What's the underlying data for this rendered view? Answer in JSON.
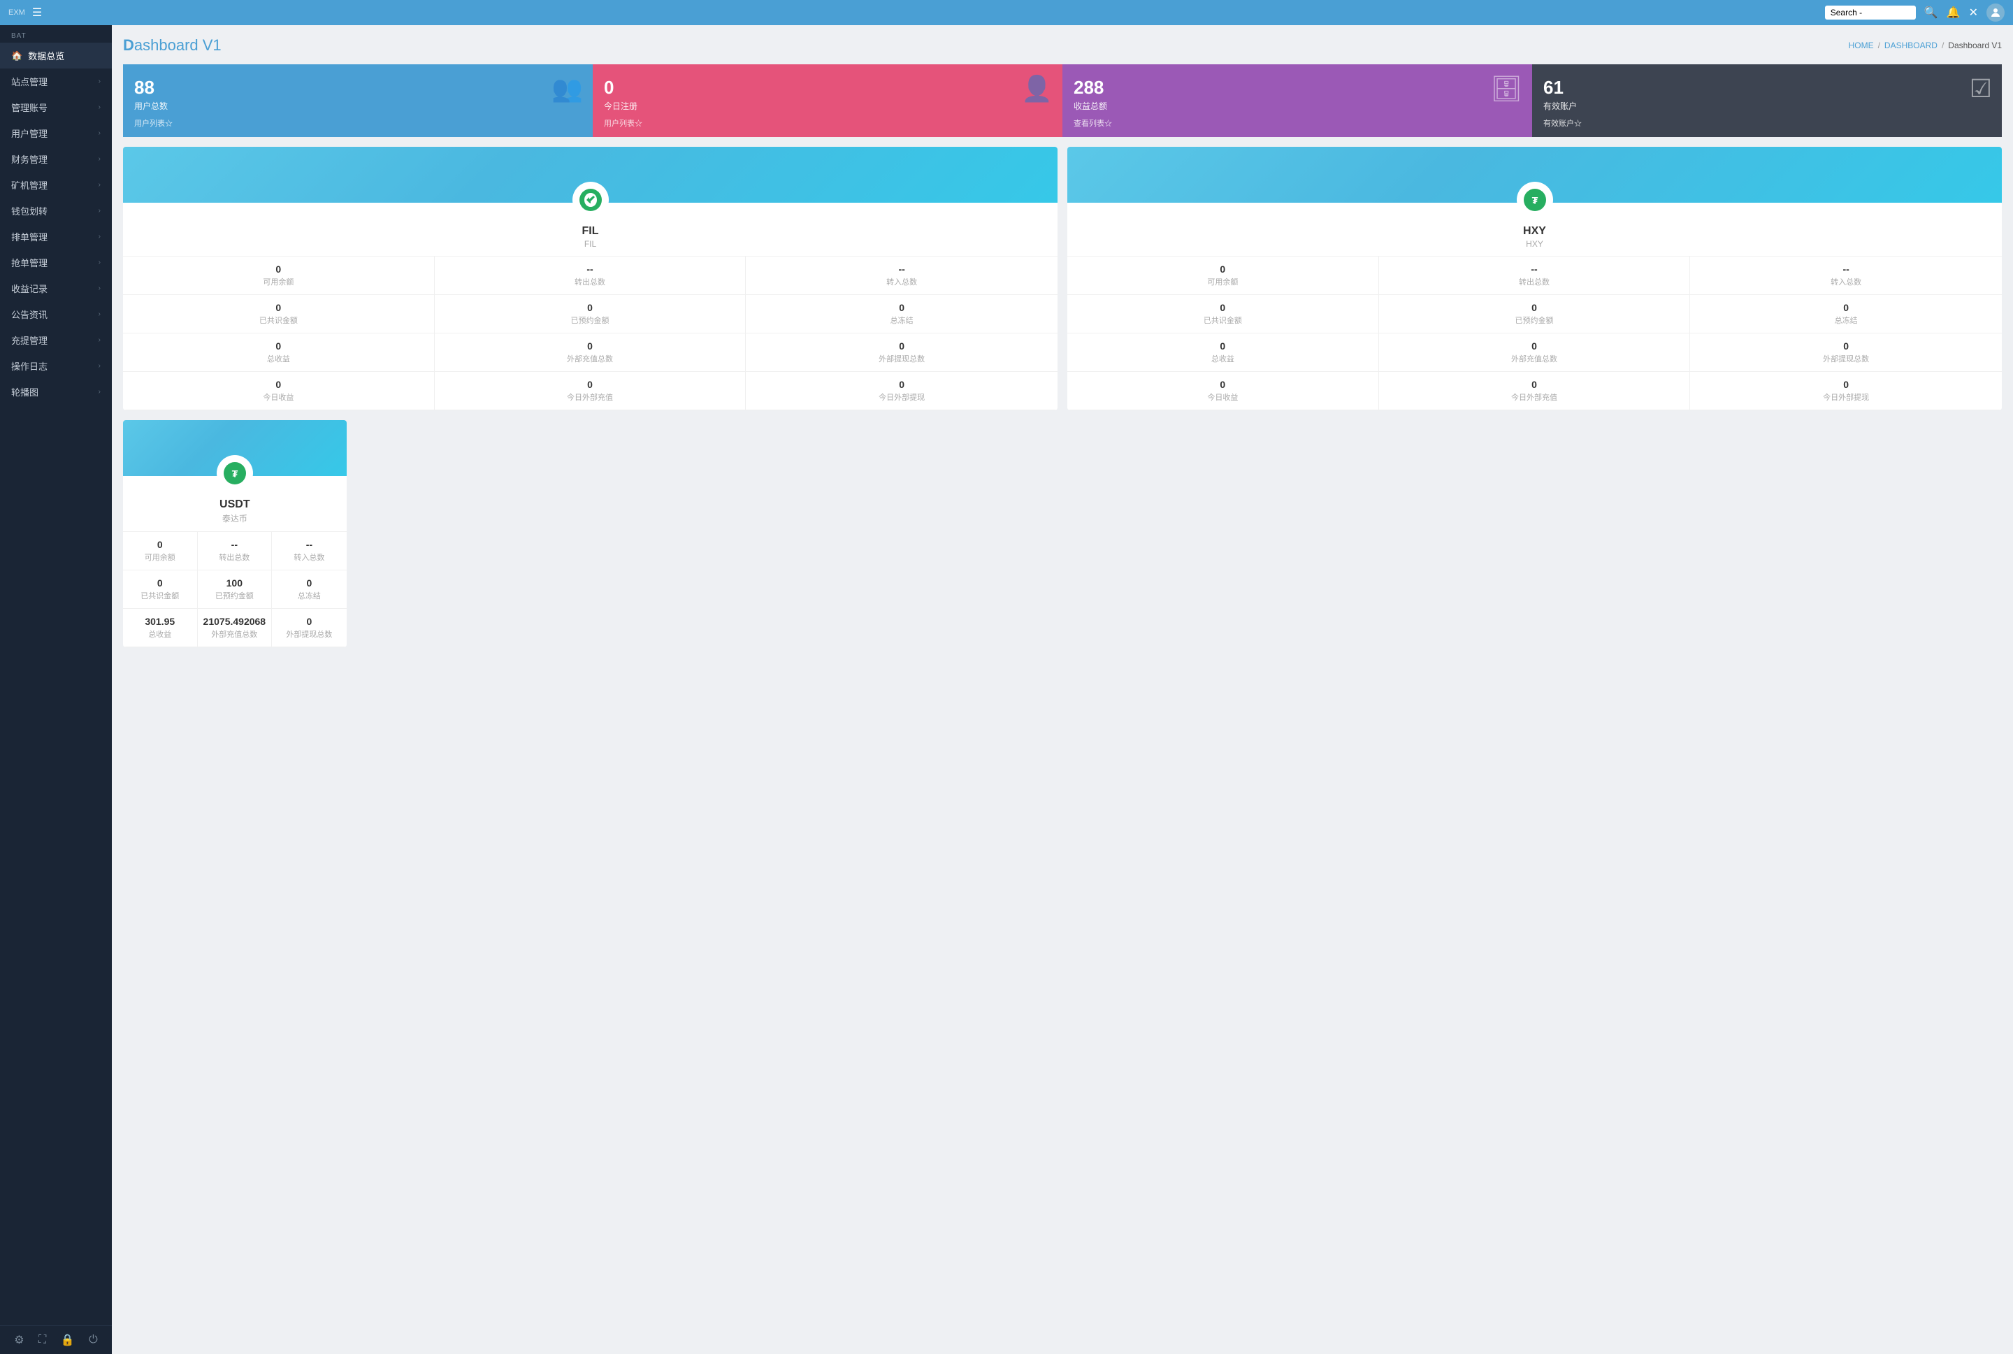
{
  "topbar": {
    "brand": "EXM",
    "hamburger_label": "☰",
    "search_placeholder": "Search...",
    "search_text": "Search -"
  },
  "sidebar": {
    "section": "BAT",
    "items": [
      {
        "id": "dashboard",
        "label": "数据总览",
        "icon": "🏠",
        "active": true,
        "has_arrow": false
      },
      {
        "id": "sites",
        "label": "站点管理",
        "icon": "",
        "active": false,
        "has_arrow": true
      },
      {
        "id": "accounts",
        "label": "管理账号",
        "icon": "",
        "active": false,
        "has_arrow": true
      },
      {
        "id": "users",
        "label": "用户管理",
        "icon": "",
        "active": false,
        "has_arrow": true
      },
      {
        "id": "finance",
        "label": "财务管理",
        "icon": "",
        "active": false,
        "has_arrow": true
      },
      {
        "id": "mining",
        "label": "矿机管理",
        "icon": "",
        "active": false,
        "has_arrow": true
      },
      {
        "id": "wallet",
        "label": "钱包划转",
        "icon": "",
        "active": false,
        "has_arrow": true
      },
      {
        "id": "orders",
        "label": "排单管理",
        "icon": "",
        "active": false,
        "has_arrow": true
      },
      {
        "id": "grab",
        "label": "抢单管理",
        "icon": "",
        "active": false,
        "has_arrow": true
      },
      {
        "id": "income",
        "label": "收益记录",
        "icon": "",
        "active": false,
        "has_arrow": true
      },
      {
        "id": "announce",
        "label": "公告资讯",
        "icon": "",
        "active": false,
        "has_arrow": true
      },
      {
        "id": "recharge",
        "label": "充提管理",
        "icon": "",
        "active": false,
        "has_arrow": true
      },
      {
        "id": "logs",
        "label": "操作日志",
        "icon": "",
        "active": false,
        "has_arrow": true
      },
      {
        "id": "banner",
        "label": "轮播图",
        "icon": "",
        "active": false,
        "has_arrow": true
      }
    ],
    "bottom_icons": [
      "⚙",
      "⛶",
      "🔒",
      "⏻"
    ]
  },
  "breadcrumb": {
    "home": "HOME",
    "sep1": "/",
    "dashboard": "DASHBOARD",
    "sep2": "/",
    "current": "Dashboard V1"
  },
  "page_title_prefix": "D",
  "page_title_rest": "ashboard V1",
  "stat_cards": [
    {
      "number": "88",
      "label": "用户总数",
      "link": "用户列表☆",
      "color": "blue",
      "icon": "👥"
    },
    {
      "number": "0",
      "label": "今日注册",
      "link": "用户列表☆",
      "color": "pink",
      "icon": "👤"
    },
    {
      "number": "288",
      "label": "收益总额",
      "link": "查看列表☆",
      "color": "purple",
      "icon": "🗄"
    },
    {
      "number": "61",
      "label": "有效账户",
      "link": "有效账户☆",
      "color": "dark",
      "icon": "☑"
    }
  ],
  "coins": [
    {
      "id": "fil",
      "name": "FIL",
      "sub": "FIL",
      "icon_type": "fil",
      "stats_rows": [
        [
          {
            "value": "0",
            "label": "可用余额"
          },
          {
            "value": "--",
            "label": "转出总数"
          },
          {
            "value": "--",
            "label": "转入总数"
          }
        ],
        [
          {
            "value": "0",
            "label": "已共识金额"
          },
          {
            "value": "0",
            "label": "已预约金额"
          },
          {
            "value": "0",
            "label": "总冻结"
          }
        ],
        [
          {
            "value": "0",
            "label": "总收益"
          },
          {
            "value": "0",
            "label": "外部充值总数"
          },
          {
            "value": "0",
            "label": "外部提现总数"
          }
        ],
        [
          {
            "value": "0",
            "label": "今日收益"
          },
          {
            "value": "0",
            "label": "今日外部充值"
          },
          {
            "value": "0",
            "label": "今日外部提现"
          }
        ]
      ]
    },
    {
      "id": "hxy",
      "name": "HXY",
      "sub": "HXY",
      "icon_type": "usdt",
      "stats_rows": [
        [
          {
            "value": "0",
            "label": "可用余额"
          },
          {
            "value": "--",
            "label": "转出总数"
          },
          {
            "value": "--",
            "label": "转入总数"
          }
        ],
        [
          {
            "value": "0",
            "label": "已共识金额"
          },
          {
            "value": "0",
            "label": "已预约金额"
          },
          {
            "value": "0",
            "label": "总冻结"
          }
        ],
        [
          {
            "value": "0",
            "label": "总收益"
          },
          {
            "value": "0",
            "label": "外部充值总数"
          },
          {
            "value": "0",
            "label": "外部提现总数"
          }
        ],
        [
          {
            "value": "0",
            "label": "今日收益"
          },
          {
            "value": "0",
            "label": "今日外部充值"
          },
          {
            "value": "0",
            "label": "今日外部提现"
          }
        ]
      ]
    },
    {
      "id": "usdt",
      "name": "USDT",
      "sub": "泰达币",
      "icon_type": "usdt",
      "stats_rows": [
        [
          {
            "value": "0",
            "label": "可用余额"
          },
          {
            "value": "--",
            "label": "转出总数"
          },
          {
            "value": "--",
            "label": "转入总数"
          }
        ],
        [
          {
            "value": "0",
            "label": "已共识金额"
          },
          {
            "value": "100",
            "label": "已预约金额"
          },
          {
            "value": "0",
            "label": "总冻结"
          }
        ],
        [
          {
            "value": "301.95",
            "label": "总收益"
          },
          {
            "value": "21075.492068",
            "label": "外部充值总数"
          },
          {
            "value": "0",
            "label": "外部提现总数"
          }
        ]
      ]
    }
  ]
}
